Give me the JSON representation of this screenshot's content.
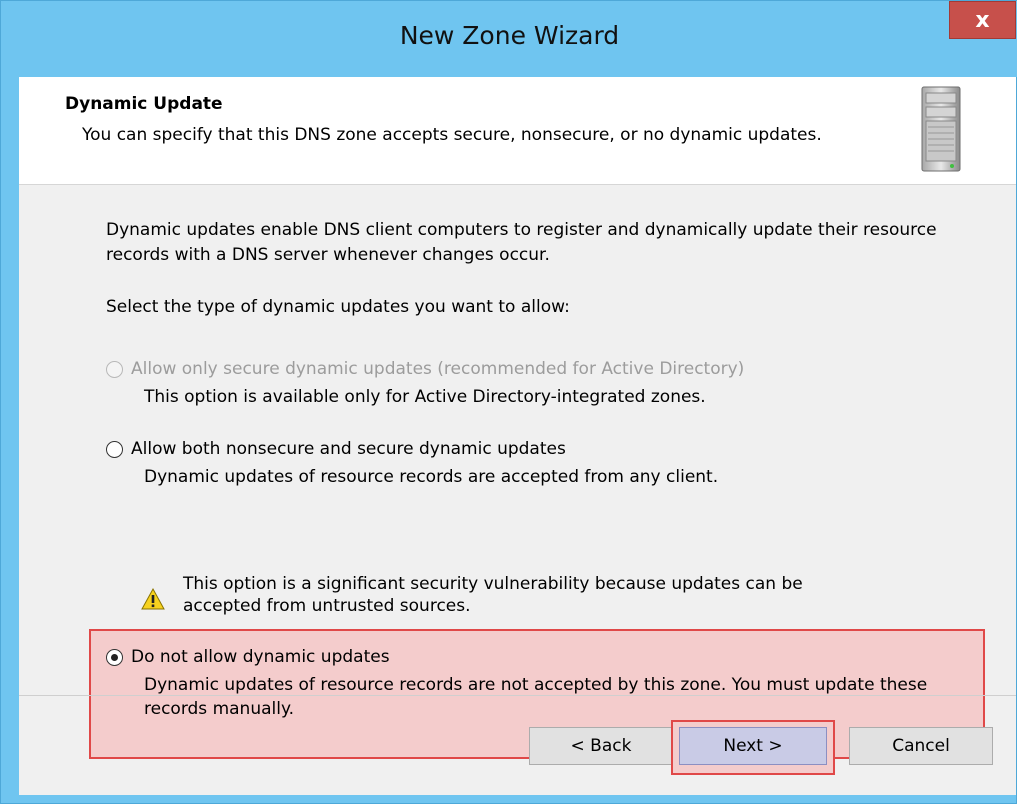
{
  "window": {
    "title": "New Zone Wizard",
    "close_label": "x"
  },
  "header": {
    "title": "Dynamic Update",
    "subtitle": "You can specify that this DNS zone accepts secure, nonsecure, or no dynamic updates."
  },
  "content": {
    "intro": "Dynamic updates enable DNS client computers to register and dynamically update their resource records with a DNS server whenever changes occur.",
    "prompt": "Select the type of dynamic updates you want to allow:",
    "options": [
      {
        "label": "Allow only secure dynamic updates (recommended for Active Directory)",
        "description": "This option is available only for Active Directory-integrated zones.",
        "enabled": false,
        "selected": false
      },
      {
        "label": "Allow both nonsecure and secure dynamic updates",
        "description": "Dynamic updates of resource records are accepted from any client.",
        "enabled": true,
        "selected": false
      },
      {
        "label": "Do not allow dynamic updates",
        "description": "Dynamic updates of resource records are not accepted by this zone. You must update these records manually.",
        "enabled": true,
        "selected": true
      }
    ],
    "warning": "This option is a significant security vulnerability because updates can be accepted from untrusted sources."
  },
  "buttons": {
    "back": "< Back",
    "next": "Next >",
    "cancel": "Cancel"
  },
  "colors": {
    "title_bar": "#6fc5f0",
    "close_button": "#c7504b",
    "highlight_fill": "#f4cccc",
    "highlight_border": "#e04848"
  },
  "icons": {
    "header": "server-icon",
    "warning": "warning-icon"
  }
}
